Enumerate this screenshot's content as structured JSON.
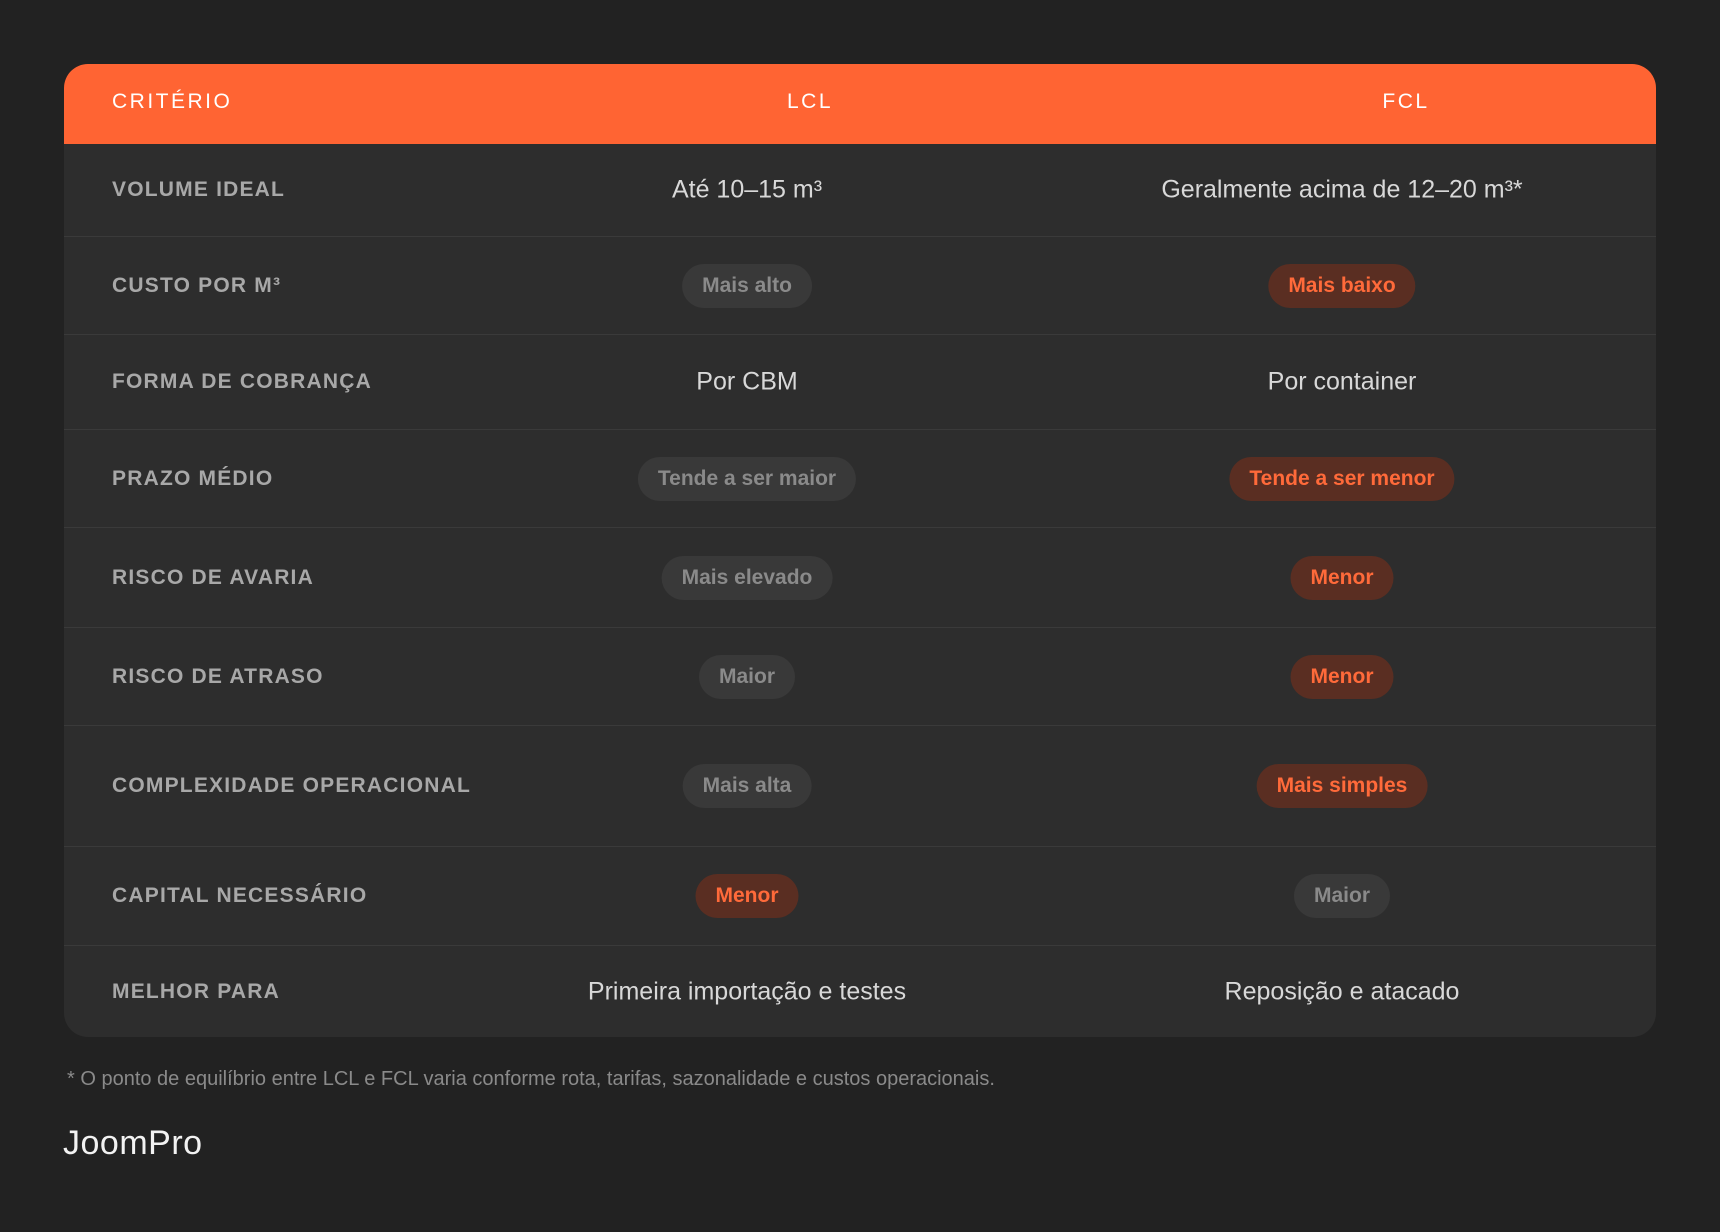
{
  "table": {
    "headers": {
      "criterio": "CRITÉRIO",
      "lcl": "LCL",
      "fcl": "FCL"
    },
    "rows": [
      {
        "criterio": "Volume ideal",
        "lcl": {
          "text": "Até 10–15 m³",
          "style": "text"
        },
        "fcl": {
          "text": "Geralmente acima de 12–20 m³*",
          "style": "text"
        }
      },
      {
        "criterio": "Custo por m³",
        "lcl": {
          "text": "Mais alto",
          "style": "muted"
        },
        "fcl": {
          "text": "Mais baixo",
          "style": "accent"
        }
      },
      {
        "criterio": "Forma de cobrança",
        "lcl": {
          "text": "Por CBM",
          "style": "text"
        },
        "fcl": {
          "text": "Por container",
          "style": "text"
        }
      },
      {
        "criterio": "Prazo médio",
        "lcl": {
          "text": "Tende a ser maior",
          "style": "muted"
        },
        "fcl": {
          "text": "Tende a ser menor",
          "style": "accent"
        }
      },
      {
        "criterio": "Risco de avaria",
        "lcl": {
          "text": "Mais elevado",
          "style": "muted"
        },
        "fcl": {
          "text": "Menor",
          "style": "accent"
        }
      },
      {
        "criterio": "Risco de atraso",
        "lcl": {
          "text": "Maior",
          "style": "muted"
        },
        "fcl": {
          "text": "Menor",
          "style": "accent"
        }
      },
      {
        "criterio": "Complexidade operacional",
        "lcl": {
          "text": "Mais alta",
          "style": "muted"
        },
        "fcl": {
          "text": "Mais simples",
          "style": "accent"
        }
      },
      {
        "criterio": "Capital necessário",
        "lcl": {
          "text": "Menor",
          "style": "accent"
        },
        "fcl": {
          "text": "Maior",
          "style": "muted"
        }
      },
      {
        "criterio": "Melhor para",
        "lcl": {
          "text": "Primeira importação e testes",
          "style": "text"
        },
        "fcl": {
          "text": "Reposição e atacado",
          "style": "text"
        }
      }
    ]
  },
  "footnote": "* O ponto de equilíbrio entre LCL e FCL varia conforme rota, tarifas, sazonalidade e custos operacionais.",
  "brand": "JoomPro",
  "colors": {
    "accent": "#ff6433",
    "background": "#222222",
    "card": "#2d2d2d"
  }
}
